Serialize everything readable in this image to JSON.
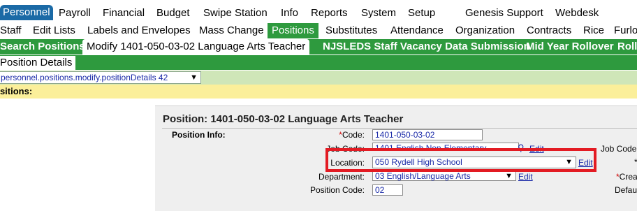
{
  "top_menu": [
    "Personnel",
    "Payroll",
    "Financial",
    "Budget",
    "Swipe Station",
    "Info",
    "Reports",
    "System",
    "Setup",
    "Genesis Support",
    "Webdesk"
  ],
  "top_menu_active": 0,
  "sub_menu": [
    "Staff",
    "Edit Lists",
    "Labels and Envelopes",
    "Mass Change",
    "Positions",
    "Substitutes",
    "Attendance",
    "Organization",
    "Contracts",
    "Rice",
    "Furlo"
  ],
  "sub_menu_active": 4,
  "green_tabs": [
    "Search Positions",
    "Modify 1401-050-03-02 Language Arts Teacher",
    "NJSLEDS Staff Vacancy Data Submission",
    "Mid Year Rollover",
    "Rollo"
  ],
  "green_tabs_active": 1,
  "detail_tab": "Position Details",
  "page_select": "personnel.positions.modify.positionDetails 42",
  "yellow_bar": "ositions:",
  "panel": {
    "title": "Position: 1401-050-03-02 Language Arts Teacher",
    "section": "Position Info:",
    "code_req": "*",
    "code_label": "Code:",
    "code_value": "1401-050-03-02",
    "job_code_label": "Job Code:",
    "job_code_value": "1401 English Non-Elementary",
    "job_code_edit": "Edit",
    "location_label": "Location:",
    "location_value": "050 Rydell High School",
    "location_edit": "Edit",
    "department_label": "Department:",
    "department_value": "03 English/Language Arts",
    "department_edit": "Edit",
    "position_code_label": "Position Code:",
    "position_code_value": "02",
    "right_job_code": "Job Code",
    "right_req_star": "*",
    "right_crea": "Crea",
    "right_default": "Defau"
  }
}
